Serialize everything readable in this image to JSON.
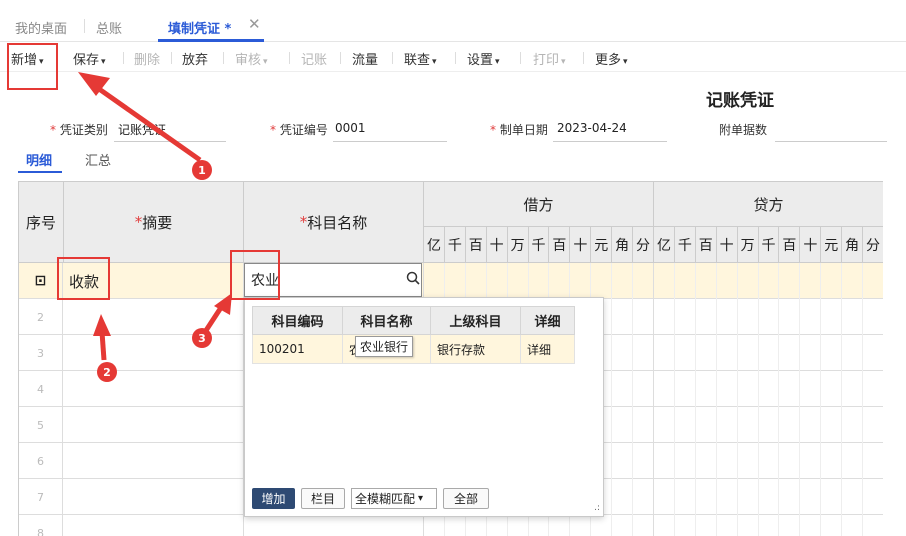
{
  "tabs": [
    {
      "label": "我的桌面"
    },
    {
      "label": "总账"
    },
    {
      "label": "填制凭证 *"
    }
  ],
  "toolbar": {
    "new": "新增",
    "save": "保存",
    "delete": "删除",
    "abandon": "放弃",
    "audit": "审核",
    "post": "记账",
    "flow": "流量",
    "link_query": "联查",
    "settings": "设置",
    "print": "打印",
    "more": "更多"
  },
  "voucher": {
    "title": "记账凭证",
    "type_label": "凭证类别",
    "type_value": "记账凭证",
    "number_label": "凭证编号",
    "number_value": "0001",
    "date_label": "制单日期",
    "date_value": "2023-04-24",
    "attachments_label": "附单据数"
  },
  "subtabs": {
    "detail": "明细",
    "summary": "汇总"
  },
  "grid": {
    "col_seq": "序号",
    "col_summary": "摘要",
    "col_subject": "科目名称",
    "col_debit": "借方",
    "col_credit": "贷方",
    "digits": [
      "亿",
      "千",
      "百",
      "十",
      "万",
      "千",
      "百",
      "十",
      "元",
      "角",
      "分"
    ],
    "rows": [
      {
        "num": "",
        "summary": "收款"
      },
      {
        "num": "2",
        "summary": ""
      },
      {
        "num": "3",
        "summary": ""
      },
      {
        "num": "4",
        "summary": ""
      },
      {
        "num": "5",
        "summary": ""
      },
      {
        "num": "6",
        "summary": ""
      },
      {
        "num": "7",
        "summary": ""
      },
      {
        "num": "8",
        "summary": ""
      }
    ],
    "subject_input_value": "农业"
  },
  "popup": {
    "headers": [
      "科目编码",
      "科目名称",
      "上级科目",
      "详细"
    ],
    "rows": [
      {
        "code": "100201",
        "name": "农",
        "parent": "银行存款",
        "detail": "详细"
      }
    ],
    "tooltip": "农业银行",
    "add_button": "增加",
    "column_button": "栏目",
    "match_select": "全模糊匹配",
    "all_button": "全部"
  },
  "annotations": [
    "1",
    "2",
    "3"
  ],
  "colors": {
    "accent": "#2b5bd7",
    "annotation_red": "#e53935",
    "active_row": "#fff6dd"
  }
}
